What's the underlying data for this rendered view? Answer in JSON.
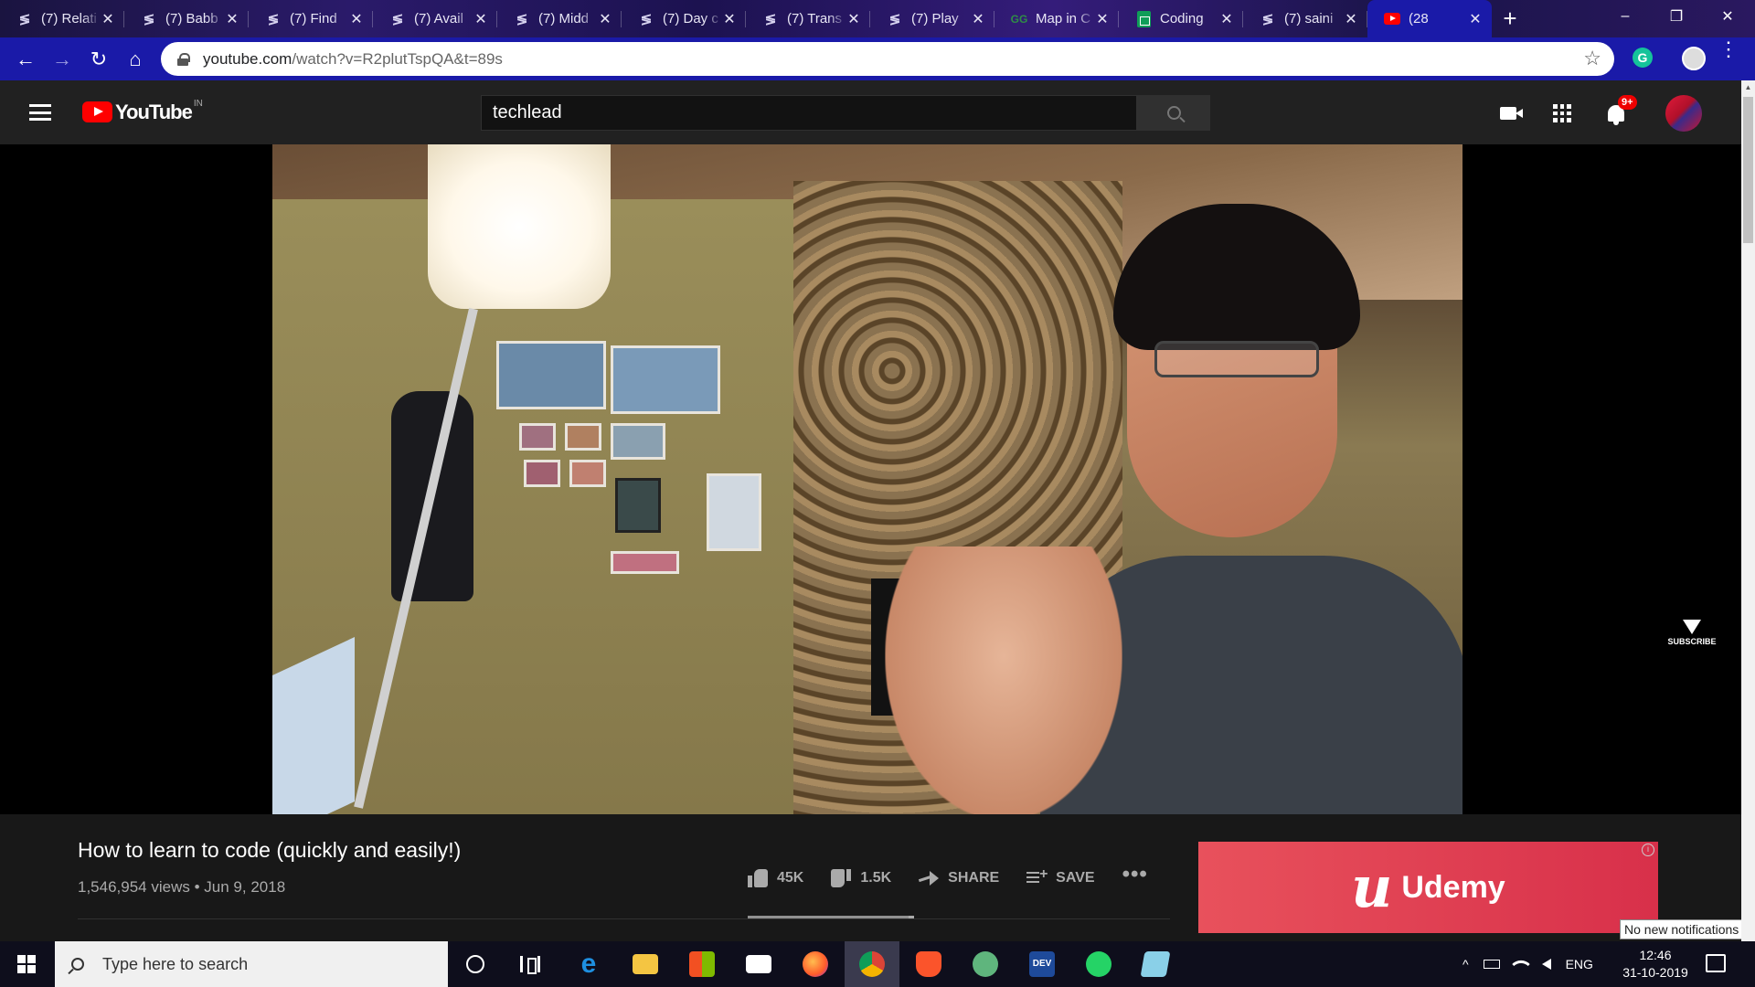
{
  "browser": {
    "tabs": [
      {
        "title": "(7) Relati",
        "icon": "stackoverflow-favicon",
        "active": false
      },
      {
        "title": "(7) Babb",
        "icon": "stackoverflow-favicon",
        "active": false
      },
      {
        "title": "(7) Find",
        "icon": "stackoverflow-favicon",
        "active": false
      },
      {
        "title": "(7) Avail",
        "icon": "stackoverflow-favicon",
        "active": false
      },
      {
        "title": "(7) Midd",
        "icon": "stackoverflow-favicon",
        "active": false
      },
      {
        "title": "(7) Day c",
        "icon": "stackoverflow-favicon",
        "active": false
      },
      {
        "title": "(7) Trans",
        "icon": "stackoverflow-favicon",
        "active": false
      },
      {
        "title": "(7) Play",
        "icon": "stackoverflow-favicon",
        "active": false
      },
      {
        "title": "Map in C",
        "icon": "gfg-favicon",
        "active": false
      },
      {
        "title": "Coding",
        "icon": "google-sheets-favicon",
        "active": false
      },
      {
        "title": "(7) saini",
        "icon": "stackoverflow-favicon",
        "active": false
      },
      {
        "title": "(28",
        "icon": "youtube-favicon",
        "active": true
      }
    ],
    "new_tab_label": "+",
    "close_glyph": "✕",
    "window_controls": {
      "minimize": "–",
      "restore": "❐",
      "close": "✕"
    },
    "url_host": "youtube.com",
    "url_path": "/watch?v=R2plutTspQA&t=89s",
    "nav": {
      "back": "←",
      "forward": "→",
      "reload": "↻",
      "home": "⌂"
    },
    "star_glyph": "☆",
    "extension_label": "G",
    "menu_glyph": "⋮"
  },
  "youtube": {
    "logo_text": "YouTube",
    "country_code": "IN",
    "search_query": "techlead",
    "notifications_badge": "9+",
    "video_title": "How to learn to code (quickly and easily!)",
    "views": "1,546,954 views",
    "date_separator": "•",
    "upload_date": "Jun 9, 2018",
    "likes": "45K",
    "dislikes": "1.5K",
    "share_label": "SHARE",
    "save_label": "SAVE",
    "more_glyph": "•••",
    "like_ratio": 0.968,
    "watermark_text": "SUBSCRIBE",
    "ad": {
      "brand": "Udemy",
      "logo_letter": "u",
      "info_glyph": "i",
      "bg_color": "#e8515c"
    }
  },
  "tooltip": "No new notifications",
  "taskbar": {
    "search_placeholder": "Type here to search",
    "apps": [
      "cortana",
      "task-view",
      "edge",
      "file-explorer",
      "microsoft-store",
      "mail",
      "firefox",
      "chrome",
      "brave",
      "atom",
      "dev-to",
      "whatsapp",
      "notes"
    ],
    "active_app": "chrome",
    "language": "ENG",
    "time": "12:46",
    "date": "31-10-2019",
    "tray_up_glyph": "^"
  },
  "colors": {
    "accent": "#1a1aa8",
    "youtube_red": "#ff0000",
    "yt_bg": "#181818"
  }
}
